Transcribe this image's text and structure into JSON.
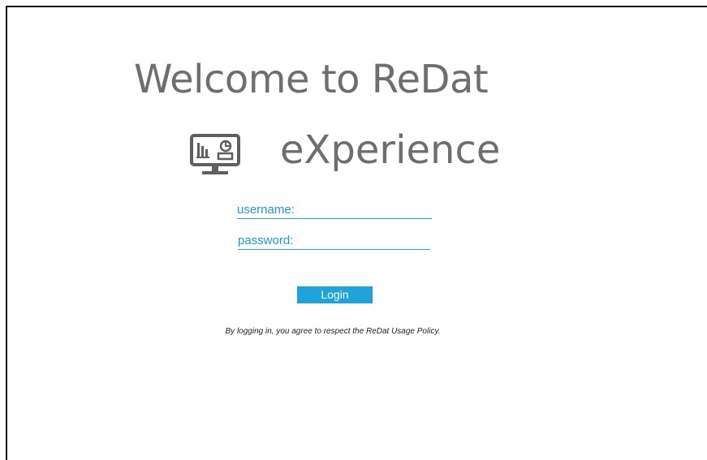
{
  "header": {
    "title_line1": "Welcome to ReDat",
    "title_line2": "eXperience"
  },
  "icon": {
    "name": "monitor-dashboard-icon",
    "color": "#5f5f5f"
  },
  "form": {
    "username_label": "username:",
    "username_value": "",
    "password_label": "password:",
    "password_value": "",
    "login_label": "Login"
  },
  "footer": {
    "policy_text": "By logging in, you agree to respect the ReDat Usage Policy."
  },
  "colors": {
    "accent": "#1ea3db",
    "title": "#6e6e6e",
    "background": "#ffffff"
  }
}
